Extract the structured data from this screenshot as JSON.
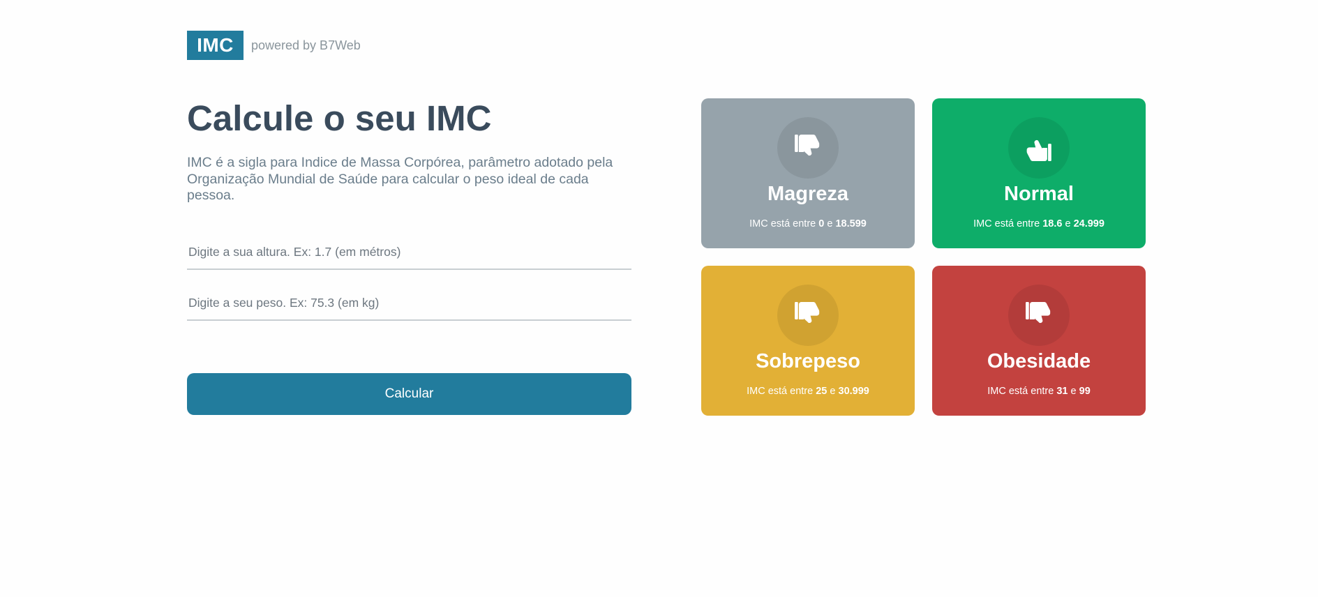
{
  "header": {
    "logo": "IMC",
    "powered_by": "powered by B7Web"
  },
  "main": {
    "title": "Calcule o seu IMC",
    "description": "IMC é a sigla para Indice de Massa Corpórea, parâmetro adotado pela Organização Mundial de Saúde para calcular o peso ideal de cada pessoa.",
    "height_placeholder": "Digite a sua altura. Ex: 1.7 (em métros)",
    "weight_placeholder": "Digite a seu peso. Ex: 75.3 (em kg)",
    "calculate_label": "Calcular"
  },
  "levels": [
    {
      "title": "Magreza",
      "range_prefix": "IMC está entre",
      "min": "0",
      "connector": "e",
      "max": "18.599",
      "color": "#96a3ab",
      "icon": "thumbs-down-icon"
    },
    {
      "title": "Normal",
      "range_prefix": "IMC está entre",
      "min": "18.6",
      "connector": "e",
      "max": "24.999",
      "color": "#0ead69",
      "icon": "thumbs-up-icon"
    },
    {
      "title": "Sobrepeso",
      "range_prefix": "IMC está entre",
      "min": "25",
      "connector": "e",
      "max": "30.999",
      "color": "#e2b036",
      "icon": "thumbs-down-icon"
    },
    {
      "title": "Obesidade",
      "range_prefix": "IMC está entre",
      "min": "31",
      "connector": "e",
      "max": "99",
      "color": "#c3423f",
      "icon": "thumbs-down-icon"
    }
  ]
}
